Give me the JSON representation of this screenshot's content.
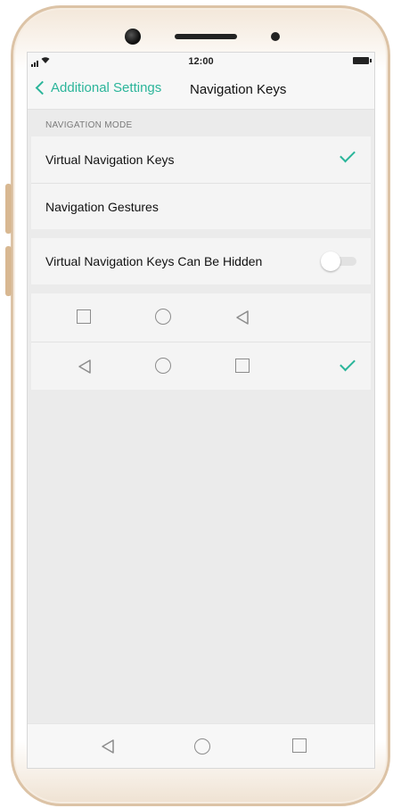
{
  "status_bar": {
    "time": "12:00"
  },
  "header": {
    "back_label": "Additional Settings",
    "title": "Navigation Keys"
  },
  "navigation_mode": {
    "section_label": "NAVIGATION MODE",
    "options": [
      {
        "label": "Virtual Navigation Keys",
        "selected": true
      },
      {
        "label": "Navigation Gestures",
        "selected": false
      }
    ]
  },
  "hide_keys": {
    "label": "Virtual Navigation Keys Can Be Hidden",
    "enabled": false
  },
  "key_layouts": [
    {
      "order": [
        "square-icon",
        "circle-icon",
        "back-triangle-icon"
      ],
      "selected": false
    },
    {
      "order": [
        "back-triangle-icon",
        "circle-icon",
        "square-icon"
      ],
      "selected": true
    }
  ],
  "system_nav": [
    "back-triangle-icon",
    "circle-icon",
    "square-icon"
  ],
  "colors": {
    "accent": "#2bb59a",
    "background": "#ebebeb",
    "row": "#f4f4f4",
    "icon": "#8c8c8c"
  }
}
